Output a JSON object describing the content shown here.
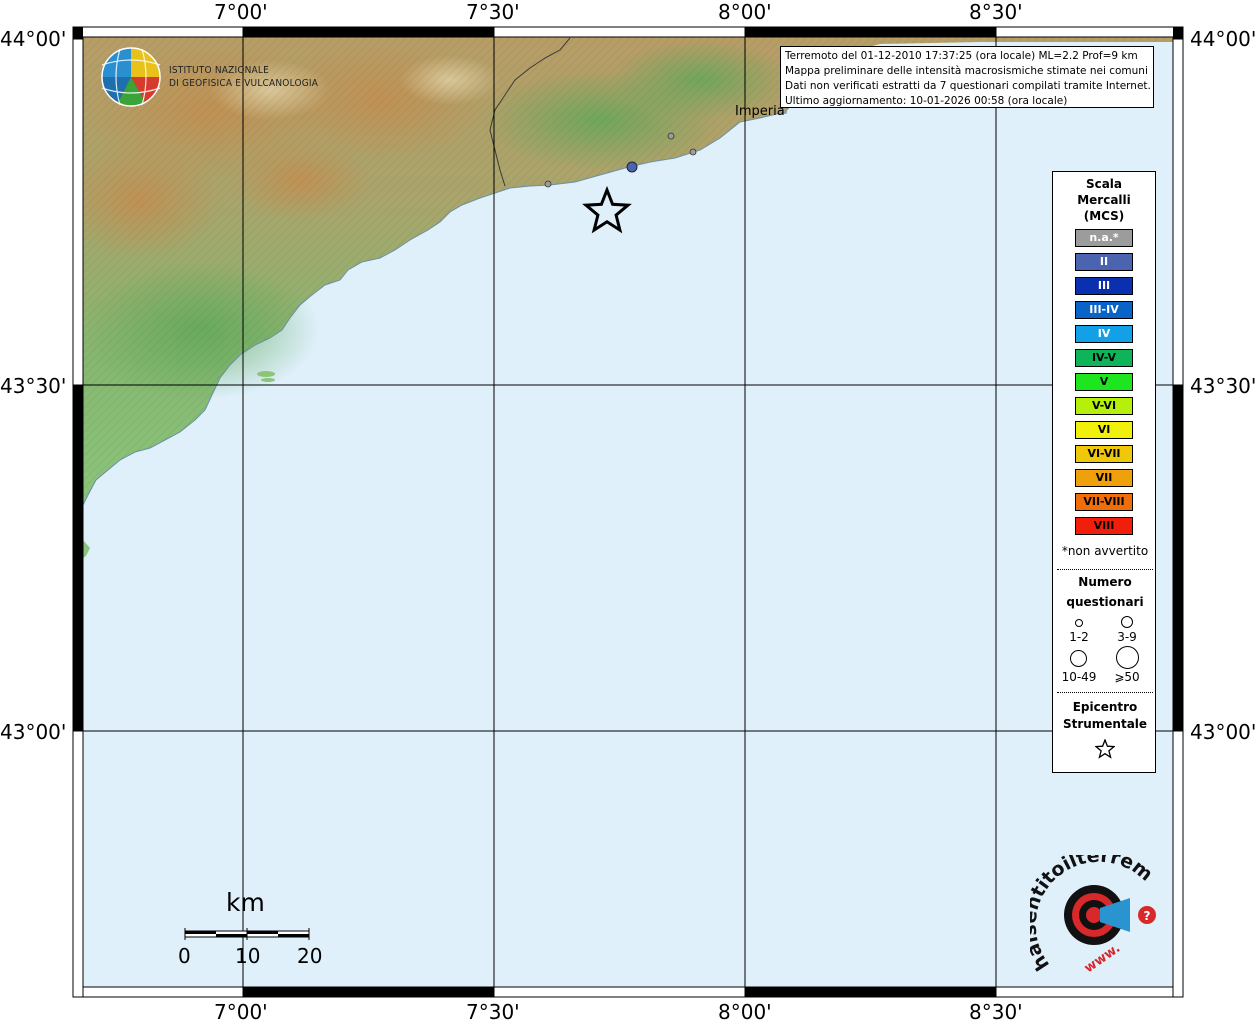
{
  "map": {
    "lon_labels": [
      "7°00'",
      "7°30'",
      "8°00'",
      "8°30'"
    ],
    "lat_labels": [
      "44°00'",
      "43°30'",
      "43°00'"
    ],
    "colors": {
      "sea": "#dff0fb",
      "grid": "#000000",
      "land_low": "#7fb86a",
      "land_high": "#b9a06a"
    }
  },
  "institute": {
    "line1": "ISTITUTO NAZIONALE",
    "line2": "DI GEOFISICA E VULCANOLOGIA",
    "logo_icon": "ingv-globe-icon"
  },
  "info": {
    "line1": "Terremoto del 01-12-2010 17:37:25 (ora locale) ML=2.2 Prof=9 km",
    "line2": "Mappa preliminare delle intensità macrosismiche stimate nei comuni",
    "line3": "Dati non verificati estratti da 7 questionari compilati tramite Internet.",
    "line4": "Ultimo aggiornamento: 10-01-2026 00:58 (ora locale)"
  },
  "city_label": "Imperia",
  "legend": {
    "title1": "Scala",
    "title2": "Mercalli",
    "title3": "(MCS)",
    "items": [
      {
        "label": "n.a.*",
        "color": "#9c9c9c",
        "text_color": "#ffffff"
      },
      {
        "label": "II",
        "color": "#4a64b0",
        "text_color": "#ffffff"
      },
      {
        "label": "III",
        "color": "#0a30b0",
        "text_color": "#ffffff"
      },
      {
        "label": "III-IV",
        "color": "#0a64c8",
        "text_color": "#ffffff"
      },
      {
        "label": "IV",
        "color": "#12a0e6",
        "text_color": "#ffffff"
      },
      {
        "label": "IV-V",
        "color": "#0fb45a",
        "text_color": "#000000"
      },
      {
        "label": "V",
        "color": "#1ee61e",
        "text_color": "#000000"
      },
      {
        "label": "V-VI",
        "color": "#b4f00a",
        "text_color": "#000000"
      },
      {
        "label": "VI",
        "color": "#f0f00a",
        "text_color": "#000000"
      },
      {
        "label": "VI-VII",
        "color": "#f0c80a",
        "text_color": "#000000"
      },
      {
        "label": "VII",
        "color": "#f0a00a",
        "text_color": "#000000"
      },
      {
        "label": "VII-VIII",
        "color": "#f06e0a",
        "text_color": "#000000"
      },
      {
        "label": "VIII",
        "color": "#f01e0a",
        "text_color": "#000000"
      }
    ],
    "note": "*non avvertito",
    "count_title1": "Numero",
    "count_title2": "questionari",
    "counts": [
      "1-2",
      "3-9",
      "10-49",
      "⩾50"
    ],
    "epicenter_title1": "Epicentro",
    "epicenter_title2": "Strumentale",
    "epicenter_icon": "star-icon"
  },
  "scale_bar": {
    "unit": "km",
    "labels": [
      "0",
      "10",
      "20"
    ]
  },
  "points": [
    {
      "name": "intensity-point-ii",
      "intensity": "II"
    },
    {
      "name": "intensity-point-na",
      "intensity": "n.a.*"
    },
    {
      "name": "intensity-point-na",
      "intensity": "n.a.*"
    },
    {
      "name": "intensity-point-na",
      "intensity": "n.a.*"
    }
  ],
  "epicenter": {
    "icon": "star-icon"
  },
  "badge": {
    "text": "haisentitoilterremoto.it",
    "www": "www.",
    "logo_icon": "target-megaphone-icon"
  }
}
